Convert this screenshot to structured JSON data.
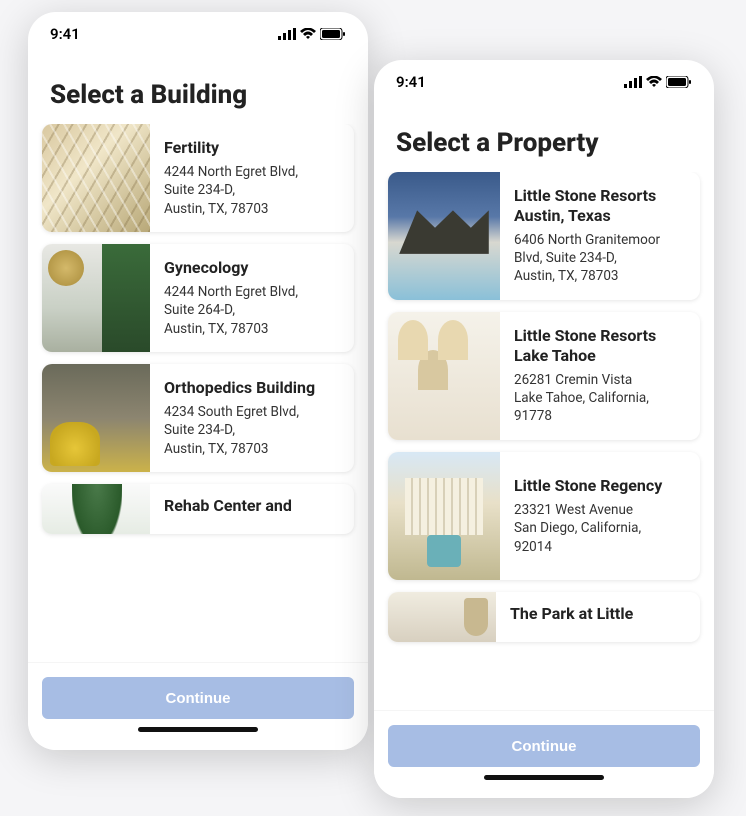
{
  "status": {
    "time": "9:41"
  },
  "continue_label": "Continue",
  "screens": {
    "left": {
      "title": "Select a Building",
      "items": [
        {
          "title": "Fertility",
          "addr": "4244 North Egret Blvd,\nSuite 234-D,\nAustin, TX, 78703"
        },
        {
          "title": "Gynecology",
          "addr": "4244 North Egret Blvd,\nSuite 264-D,\nAustin, TX, 78703"
        },
        {
          "title": "Orthopedics Building",
          "addr": "4234 South Egret Blvd,\nSuite 234-D,\nAustin, TX, 78703"
        },
        {
          "title": "Rehab Center and",
          "addr": ""
        }
      ]
    },
    "right": {
      "title": "Select a Property",
      "items": [
        {
          "title": "Little Stone Resorts Austin, Texas",
          "addr": "6406 North Granitemoor\nBlvd, Suite 234-D,\nAustin, TX, 78703"
        },
        {
          "title": "Little Stone Resorts Lake Tahoe",
          "addr": "26281 Cremin Vista\nLake Tahoe, California,\n91778"
        },
        {
          "title": "Little Stone Regency",
          "addr": "23321 West Avenue\nSan Diego, California,\n92014"
        },
        {
          "title": "The Park at Little",
          "addr": ""
        }
      ]
    }
  }
}
